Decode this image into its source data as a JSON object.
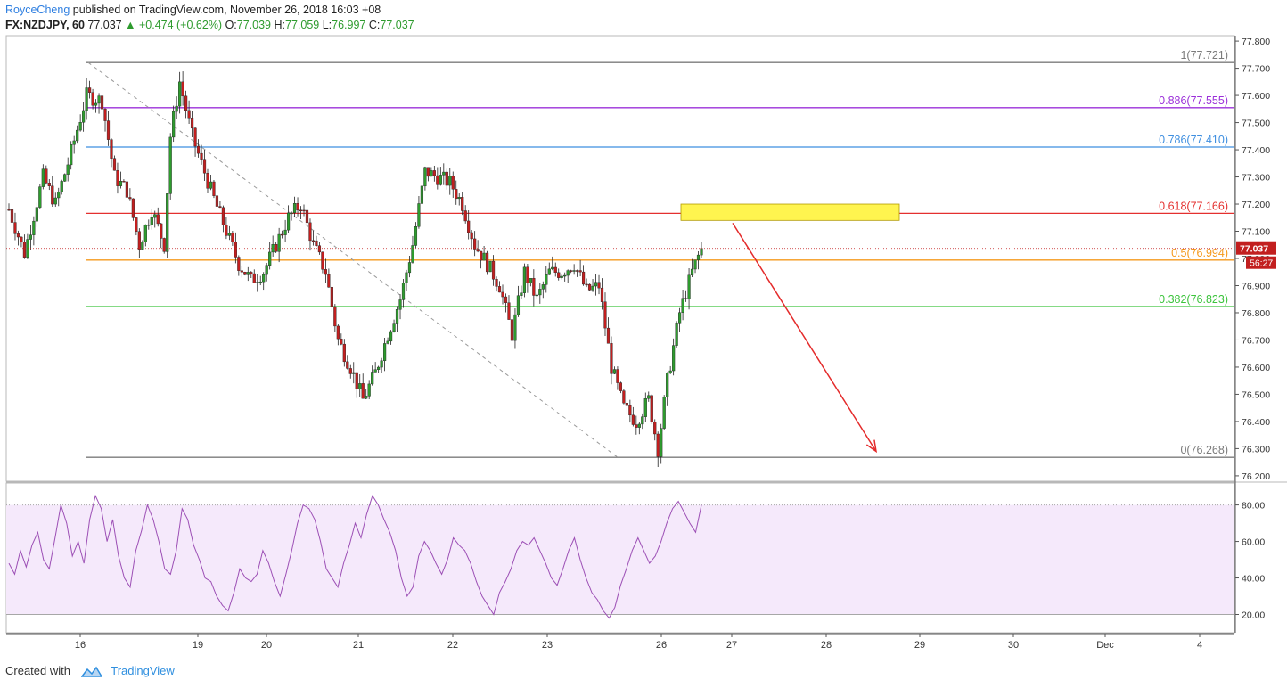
{
  "header": {
    "author": "RoyceCheng",
    "published": "published on TradingView.com, November 26, 2018 16:03 +08",
    "symbol": "FX:NZDJPY, 60",
    "price": "77.037",
    "change": "▲ +0.474 (+0.62%)",
    "o_label": "O:",
    "o": "77.039",
    "h_label": "H:",
    "h": "77.059",
    "l_label": "L:",
    "l": "76.997",
    "c_label": "C:",
    "c": "77.037"
  },
  "footer": {
    "created_with": "Created with",
    "brand": "TradingView"
  },
  "colors": {
    "candle_up": "#2e9b2e",
    "candle_down": "#c21f1f",
    "fib_0": "#7b7b7b",
    "fib_0382": "#3cc43c",
    "fib_05": "#f59a1c",
    "fib_0618": "#e4302f",
    "fib_0786": "#3f8fe0",
    "fib_0886": "#9b30d9",
    "fib_1": "#7b7b7b",
    "rsi_line": "#9c4fb5",
    "rsi_band": "#f5e9fb",
    "highlight_box": "#fff44f",
    "arrow": "#e42b2b"
  },
  "chart_data": [
    {
      "type": "candlestick",
      "symbol": "FX:NZDJPY",
      "interval": "60",
      "y_ticks": [
        "77.800",
        "77.700",
        "77.600",
        "77.500",
        "77.400",
        "77.300",
        "77.200",
        "77.100",
        "77.000",
        "76.900",
        "76.800",
        "76.700",
        "76.600",
        "76.500",
        "76.400",
        "76.300",
        "76.200"
      ],
      "ylim": [
        76.18,
        77.82
      ],
      "x_ticks": [
        "16",
        "19",
        "20",
        "21",
        "22",
        "23",
        "26",
        "27",
        "28",
        "29",
        "30",
        "Dec",
        "4"
      ],
      "last_price": "77.037",
      "countdown": "56:27",
      "fibonacci": [
        {
          "level": "1",
          "price": "77.721"
        },
        {
          "level": "0.886",
          "price": "77.555"
        },
        {
          "level": "0.786",
          "price": "77.410"
        },
        {
          "level": "0.618",
          "price": "77.166"
        },
        {
          "level": "0.5",
          "price": "76.994"
        },
        {
          "level": "0.382",
          "price": "76.823"
        },
        {
          "level": "0",
          "price": "76.268"
        }
      ],
      "highlight_zone": {
        "price_low": 77.14,
        "price_high": 77.2
      },
      "projection_arrow": {
        "from_price": 77.13,
        "to_price": 76.29
      },
      "anchors": [
        {
          "bar": 0,
          "price": 77.18
        },
        {
          "bar": 5,
          "price": 77.02
        },
        {
          "bar": 11,
          "price": 77.3
        },
        {
          "bar": 15,
          "price": 77.2
        },
        {
          "bar": 19,
          "price": 77.35
        },
        {
          "bar": 25,
          "price": 77.6
        },
        {
          "bar": 30,
          "price": 77.58
        },
        {
          "bar": 34,
          "price": 77.3
        },
        {
          "bar": 38,
          "price": 77.25
        },
        {
          "bar": 42,
          "price": 77.05
        },
        {
          "bar": 46,
          "price": 77.18
        },
        {
          "bar": 50,
          "price": 77.05
        },
        {
          "bar": 52,
          "price": 77.45
        },
        {
          "bar": 55,
          "price": 77.65
        },
        {
          "bar": 59,
          "price": 77.45
        },
        {
          "bar": 62,
          "price": 77.35
        },
        {
          "bar": 66,
          "price": 77.22
        },
        {
          "bar": 70,
          "price": 77.1
        },
        {
          "bar": 74,
          "price": 76.98
        },
        {
          "bar": 78,
          "price": 76.92
        },
        {
          "bar": 82,
          "price": 76.95
        },
        {
          "bar": 86,
          "price": 77.05
        },
        {
          "bar": 90,
          "price": 77.15
        },
        {
          "bar": 94,
          "price": 77.2
        },
        {
          "bar": 98,
          "price": 77.05
        },
        {
          "bar": 102,
          "price": 76.95
        },
        {
          "bar": 106,
          "price": 76.7
        },
        {
          "bar": 110,
          "price": 76.6
        },
        {
          "bar": 114,
          "price": 76.48
        },
        {
          "bar": 118,
          "price": 76.58
        },
        {
          "bar": 122,
          "price": 76.72
        },
        {
          "bar": 126,
          "price": 76.85
        },
        {
          "bar": 130,
          "price": 77.05
        },
        {
          "bar": 134,
          "price": 77.32
        },
        {
          "bar": 138,
          "price": 77.3
        },
        {
          "bar": 142,
          "price": 77.28
        },
        {
          "bar": 146,
          "price": 77.2
        },
        {
          "bar": 150,
          "price": 77.05
        },
        {
          "bar": 154,
          "price": 76.98
        },
        {
          "bar": 158,
          "price": 76.9
        },
        {
          "bar": 162,
          "price": 76.72
        },
        {
          "bar": 166,
          "price": 76.95
        },
        {
          "bar": 170,
          "price": 76.85
        },
        {
          "bar": 174,
          "price": 76.95
        },
        {
          "bar": 178,
          "price": 76.95
        },
        {
          "bar": 182,
          "price": 76.98
        },
        {
          "bar": 186,
          "price": 76.88
        },
        {
          "bar": 190,
          "price": 76.9
        },
        {
          "bar": 194,
          "price": 76.6
        },
        {
          "bar": 198,
          "price": 76.45
        },
        {
          "bar": 202,
          "price": 76.4
        },
        {
          "bar": 206,
          "price": 76.48
        },
        {
          "bar": 209,
          "price": 76.3
        },
        {
          "bar": 212,
          "price": 76.55
        },
        {
          "bar": 216,
          "price": 76.8
        },
        {
          "bar": 220,
          "price": 76.95
        },
        {
          "bar": 223,
          "price": 77.037
        }
      ],
      "bars_total": 224
    },
    {
      "type": "line",
      "name": "RSI",
      "y_ticks": [
        "80.00",
        "60.00",
        "40.00",
        "20.00"
      ],
      "ylim": [
        10,
        92
      ],
      "band": [
        20,
        80
      ],
      "values": [
        48,
        42,
        55,
        46,
        58,
        65,
        50,
        45,
        62,
        80,
        70,
        52,
        60,
        48,
        72,
        85,
        78,
        60,
        72,
        52,
        40,
        35,
        55,
        66,
        80,
        72,
        60,
        45,
        42,
        55,
        78,
        72,
        58,
        50,
        40,
        38,
        30,
        25,
        22,
        32,
        45,
        40,
        38,
        42,
        55,
        48,
        38,
        30,
        42,
        55,
        70,
        80,
        78,
        72,
        60,
        45,
        40,
        35,
        48,
        58,
        70,
        62,
        75,
        85,
        80,
        72,
        65,
        55,
        40,
        30,
        35,
        52,
        60,
        55,
        48,
        42,
        50,
        62,
        58,
        55,
        48,
        38,
        30,
        25,
        20,
        32,
        38,
        45,
        55,
        60,
        58,
        62,
        55,
        48,
        40,
        36,
        45,
        55,
        62,
        50,
        40,
        32,
        28,
        22,
        18,
        24,
        36,
        45,
        55,
        62,
        55,
        48,
        52,
        60,
        70,
        78,
        82,
        76,
        70,
        65,
        80
      ],
      "x_ticks": [
        "16",
        "19",
        "20",
        "21",
        "22",
        "23",
        "26",
        "27",
        "28",
        "29",
        "30",
        "Dec",
        "4"
      ]
    }
  ]
}
